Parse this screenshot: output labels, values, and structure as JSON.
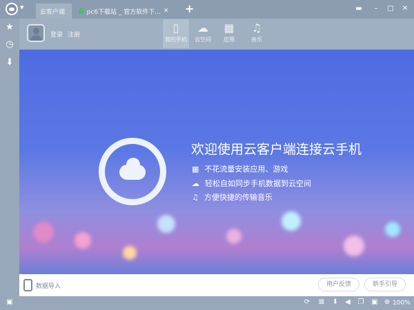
{
  "titlebar": {
    "tabs": [
      {
        "label": "云客户端"
      },
      {
        "label": "pc6下载站 _ 官方软件下...",
        "favicon": "6"
      }
    ],
    "new_tab": "+"
  },
  "user": {
    "login": "登录",
    "register": "注册"
  },
  "nav": [
    {
      "label": "我的手机",
      "icon": "phone-icon"
    },
    {
      "label": "云空间",
      "icon": "cloud-sync-icon"
    },
    {
      "label": "应用",
      "icon": "apps-grid-icon"
    },
    {
      "label": "音乐",
      "icon": "music-icon"
    }
  ],
  "banner": {
    "title": "欢迎使用云客户端连接云手机",
    "features": [
      "不花流量安装应用、游戏",
      "轻松自如同步手机数据到云空间",
      "方便快捷的传输音乐"
    ]
  },
  "bottom": {
    "import": "数据导入",
    "feedback": "用户反馈",
    "guide": "新手引导"
  },
  "status": {
    "zoom": "100%"
  }
}
